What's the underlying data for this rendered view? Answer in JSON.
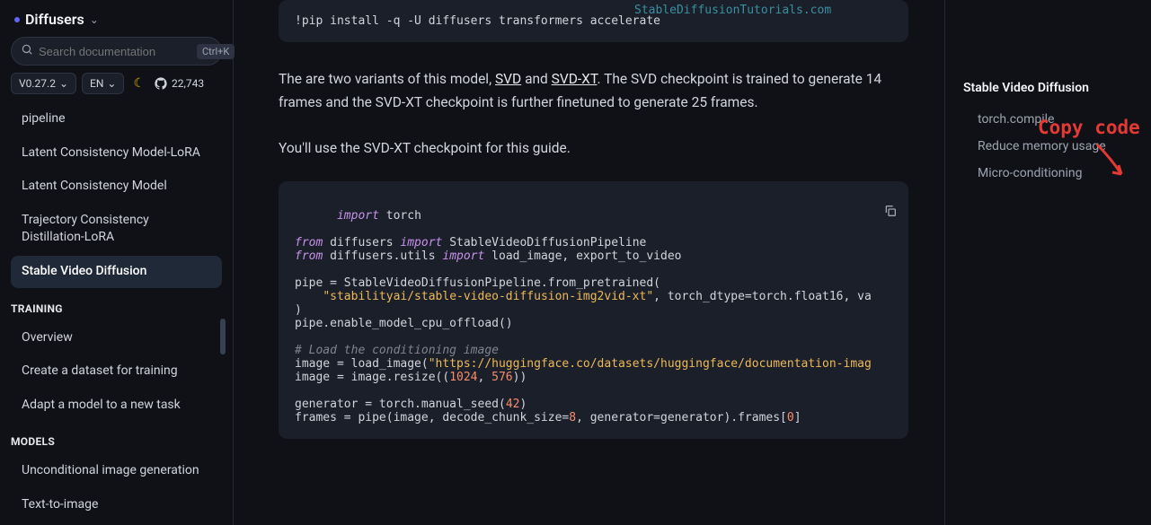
{
  "brand": "Diffusers",
  "search": {
    "placeholder": "Search documentation",
    "kbd": "Ctrl+K"
  },
  "controls": {
    "version": "V0.27.2",
    "lang": "EN",
    "stars": "22,743"
  },
  "sidebar": {
    "upper": [
      "pipeline",
      "Latent Consistency Model-LoRA",
      "Latent Consistency Model",
      "Trajectory Consistency Distillation-LoRA",
      "Stable Video Diffusion"
    ],
    "heading1": "TRAINING",
    "training": [
      "Overview",
      "Create a dataset for training",
      "Adapt a model to a new task"
    ],
    "heading2": "MODELS",
    "models": [
      "Unconditional image generation",
      "Text-to-image"
    ]
  },
  "code1": "!pip install -q -U diffusers transformers accelerate",
  "para1a": "The are two variants of this model, ",
  "link1": "SVD",
  "para1b": " and ",
  "link2": "SVD-XT",
  "para1c": ". The SVD checkpoint is trained to generate 14 frames and the SVD-XT checkpoint is further finetuned to generate 25 frames.",
  "para2": "You'll use the SVD-XT checkpoint for this guide.",
  "code2": {
    "l1a": "import",
    "l1b": " torch",
    "l2a": "from",
    "l2b": " diffusers ",
    "l2c": "import",
    "l2d": " StableVideoDiffusionPipeline",
    "l3a": "from",
    "l3b": " diffusers.utils ",
    "l3c": "import",
    "l3d": " load_image, export_to_video",
    "l4": "pipe = StableVideoDiffusionPipeline.from_pretrained(",
    "l5a": "    ",
    "l5b": "\"stabilityai/stable-video-diffusion-img2vid-xt\"",
    "l5c": ", torch_dtype=torch.float16, va",
    "l6": ")",
    "l7": "pipe.enable_model_cpu_offload()",
    "l8": "# Load the conditioning image",
    "l9a": "image = load_image(",
    "l9b": "\"https://huggingface.co/datasets/huggingface/documentation-imag",
    "l10a": "image = image.resize((",
    "l10b": "1024",
    "l10c": ", ",
    "l10d": "576",
    "l10e": "))",
    "l11a": "generator = torch.manual_seed(",
    "l11b": "42",
    "l11c": ")",
    "l12a": "frames = pipe(image, decode_chunk_size=",
    "l12b": "8",
    "l12c": ", generator=generator).frames[",
    "l12d": "0",
    "l12e": "]"
  },
  "toc": {
    "title": "Stable Video Diffusion",
    "items": [
      "torch.compile",
      "Reduce memory usage",
      "Micro-conditioning"
    ]
  },
  "watermark": "StableDiffusionTutorials.com",
  "annotation": "Copy code"
}
